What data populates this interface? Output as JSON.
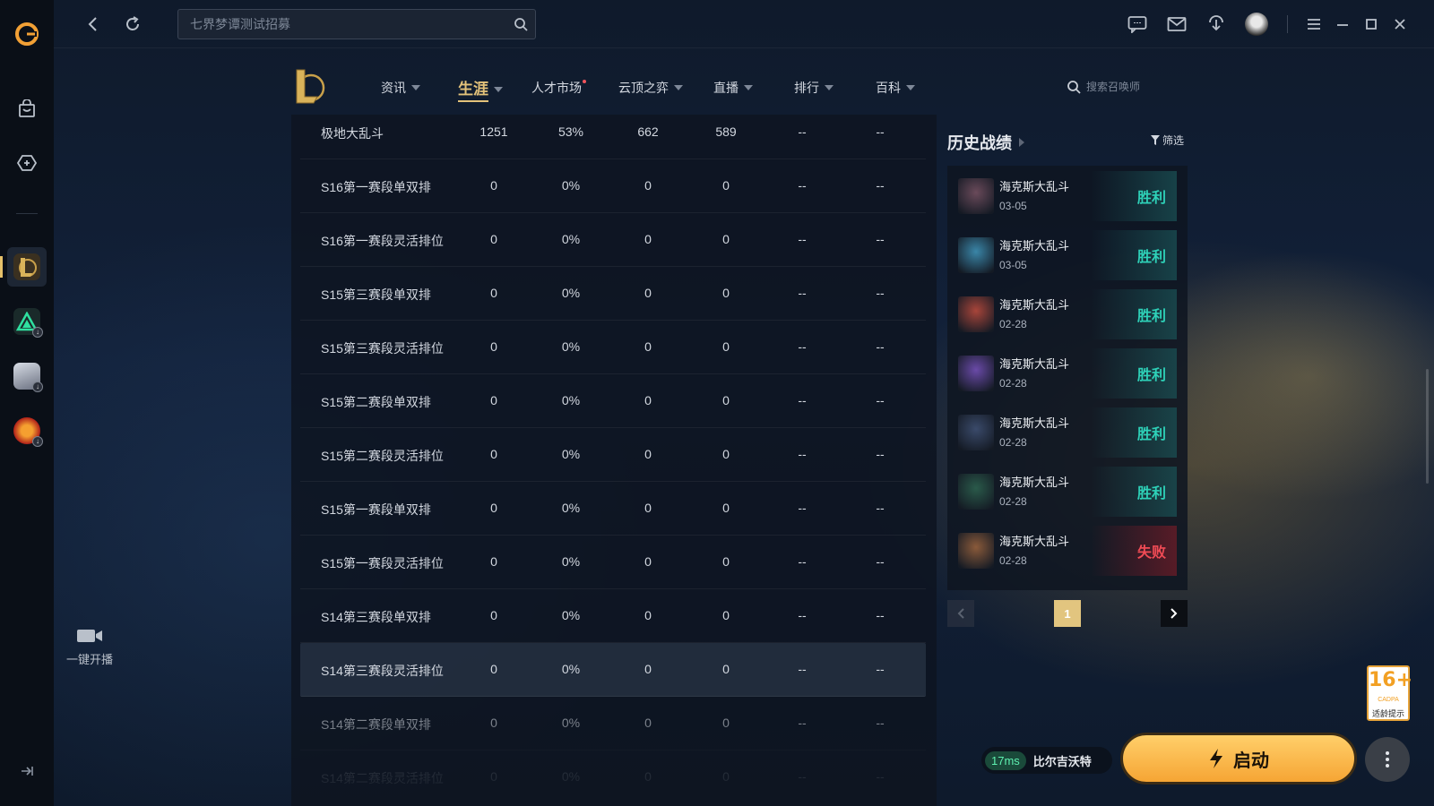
{
  "search": {
    "placeholder": "七界梦谭测试招募"
  },
  "rail": {
    "logo": "wegame-logo-icon",
    "items": [
      "shop-icon",
      "game-library-icon",
      "lol-game-icon",
      "valorant-like-game-icon",
      "character-game-icon",
      "crossfire-game-icon"
    ],
    "live_label": "一键开播"
  },
  "nav": {
    "items": [
      {
        "label": "资讯",
        "caret": true
      },
      {
        "label": "生涯",
        "caret": true,
        "active": true
      },
      {
        "label": "人才市场",
        "dot": true
      },
      {
        "label": "云顶之弈",
        "caret": true
      },
      {
        "label": "直播",
        "caret": true
      },
      {
        "label": "排行",
        "caret": true
      },
      {
        "label": "百科",
        "caret": true
      }
    ],
    "search_placeholder": "搜索召唤师"
  },
  "table": {
    "rows": [
      [
        "极地大乱斗",
        "1251",
        "53%",
        "662",
        "589",
        "--",
        "--"
      ],
      [
        "S16第一赛段单双排",
        "0",
        "0%",
        "0",
        "0",
        "--",
        "--"
      ],
      [
        "S16第一赛段灵活排位",
        "0",
        "0%",
        "0",
        "0",
        "--",
        "--"
      ],
      [
        "S15第三赛段单双排",
        "0",
        "0%",
        "0",
        "0",
        "--",
        "--"
      ],
      [
        "S15第三赛段灵活排位",
        "0",
        "0%",
        "0",
        "0",
        "--",
        "--"
      ],
      [
        "S15第二赛段单双排",
        "0",
        "0%",
        "0",
        "0",
        "--",
        "--"
      ],
      [
        "S15第二赛段灵活排位",
        "0",
        "0%",
        "0",
        "0",
        "--",
        "--"
      ],
      [
        "S15第一赛段单双排",
        "0",
        "0%",
        "0",
        "0",
        "--",
        "--"
      ],
      [
        "S15第一赛段灵活排位",
        "0",
        "0%",
        "0",
        "0",
        "--",
        "--"
      ],
      [
        "S14第三赛段单双排",
        "0",
        "0%",
        "0",
        "0",
        "--",
        "--"
      ],
      [
        "S14第三赛段灵活排位",
        "0",
        "0%",
        "0",
        "0",
        "--",
        "--"
      ],
      [
        "S14第二赛段单双排",
        "0",
        "0%",
        "0",
        "0",
        "--",
        "--"
      ],
      [
        "S14第二赛段灵活排位",
        "0",
        "0%",
        "0",
        "0",
        "--",
        "--"
      ]
    ]
  },
  "history": {
    "title": "历史战绩",
    "filter_label": "筛选",
    "matches": [
      {
        "mode": "海克斯大乱斗",
        "date": "03-05",
        "result": "胜利",
        "win": true,
        "color": "#6a4a5a"
      },
      {
        "mode": "海克斯大乱斗",
        "date": "03-05",
        "result": "胜利",
        "win": true,
        "color": "#3a86a8"
      },
      {
        "mode": "海克斯大乱斗",
        "date": "02-28",
        "result": "胜利",
        "win": true,
        "color": "#a8453a"
      },
      {
        "mode": "海克斯大乱斗",
        "date": "02-28",
        "result": "胜利",
        "win": true,
        "color": "#6a4aa8"
      },
      {
        "mode": "海克斯大乱斗",
        "date": "02-28",
        "result": "胜利",
        "win": true,
        "color": "#3a4a6a"
      },
      {
        "mode": "海克斯大乱斗",
        "date": "02-28",
        "result": "胜利",
        "win": true,
        "color": "#2a5a4a"
      },
      {
        "mode": "海克斯大乱斗",
        "date": "02-28",
        "result": "失败",
        "win": false,
        "color": "#8a5a3a"
      }
    ],
    "page": "1"
  },
  "age_rating": {
    "number": "16+",
    "org": "CADPA",
    "text": "适龄提示"
  },
  "launch": {
    "ping": "17ms",
    "server": "比尔吉沃特",
    "button_label": "启动"
  },
  "colors": {
    "accent": "#e3c27a",
    "win": "#2ed1b8",
    "loss": "#f04b55",
    "launch": "#f6a534"
  }
}
